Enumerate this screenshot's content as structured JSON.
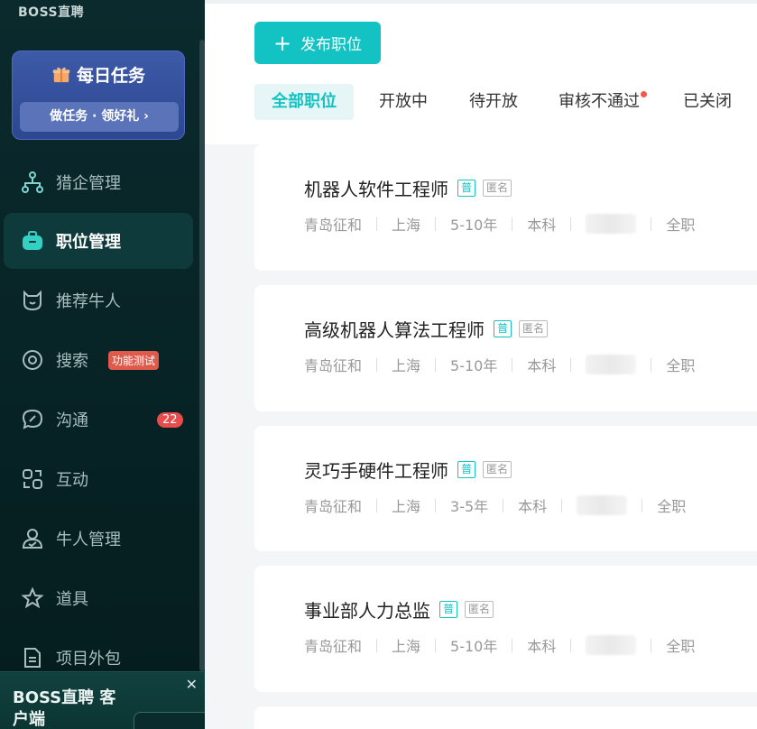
{
  "app": {
    "brand": "BOSS直聘"
  },
  "task_card": {
    "title": "每日任务",
    "button": "做任务 · 领好礼 ›"
  },
  "sidebar": {
    "items": [
      {
        "label": "猎企管理",
        "icon": "org-chart-icon",
        "active": false
      },
      {
        "label": "职位管理",
        "icon": "briefcase-icon",
        "active": true
      },
      {
        "label": "推荐牛人",
        "icon": "cat-face-icon",
        "active": false
      },
      {
        "label": "搜索",
        "icon": "search-circle-icon",
        "active": false,
        "badge": "功能测试"
      },
      {
        "label": "沟通",
        "icon": "chat-icon",
        "active": false,
        "badge": "22"
      },
      {
        "label": "互动",
        "icon": "interaction-icon",
        "active": false
      },
      {
        "label": "牛人管理",
        "icon": "person-icon",
        "active": false
      },
      {
        "label": "道具",
        "icon": "star-icon",
        "active": false
      },
      {
        "label": "项目外包",
        "icon": "document-icon",
        "active": false
      }
    ]
  },
  "client_panel": {
    "title": "BOSS直聘 客户端",
    "close": "✕"
  },
  "toolbar": {
    "publish_label": "发布职位",
    "publish_icon": "+"
  },
  "tabs": [
    {
      "label": "全部职位",
      "active": true
    },
    {
      "label": "开放中"
    },
    {
      "label": "待开放"
    },
    {
      "label": "审核不通过",
      "dot": true
    },
    {
      "label": "已关闭"
    }
  ],
  "jobs": [
    {
      "title": "机器人软件工程师",
      "tag1": "普",
      "tag2": "匿名",
      "company": "青岛征和",
      "city": "上海",
      "experience": "5-10年",
      "education": "本科",
      "type": "全职"
    },
    {
      "title": "高级机器人算法工程师",
      "tag1": "普",
      "tag2": "匿名",
      "company": "青岛征和",
      "city": "上海",
      "experience": "5-10年",
      "education": "本科",
      "type": "全职"
    },
    {
      "title": "灵巧手硬件工程师",
      "tag1": "普",
      "tag2": "匿名",
      "company": "青岛征和",
      "city": "上海",
      "experience": "3-5年",
      "education": "本科",
      "type": "全职"
    },
    {
      "title": "事业部人力总监",
      "tag1": "普",
      "tag2": "匿名",
      "company": "青岛征和",
      "city": "上海",
      "experience": "5-10年",
      "education": "本科",
      "type": "全职"
    }
  ],
  "colors": {
    "accent": "#13c2c2",
    "sidebar_bg": "#062224",
    "badge_red": "#e84d4d"
  }
}
